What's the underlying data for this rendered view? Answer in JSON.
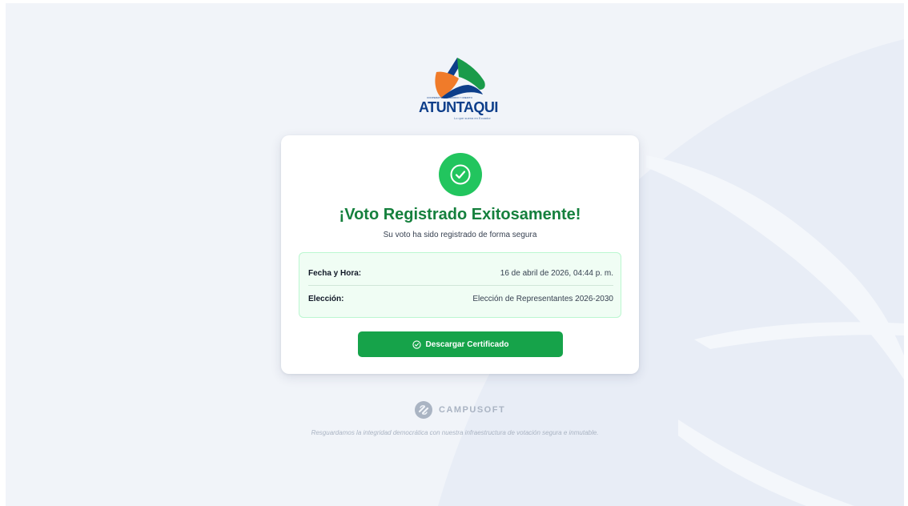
{
  "logo": {
    "wordmark": "ATUNTAQUI",
    "top_line": "COOPERATIVA DE AHORRO Y CREDITO",
    "slogan": "Lo que suena en Ecuador"
  },
  "result": {
    "title": "¡Voto Registrado Exitosamente!",
    "subtitle": "Su voto ha sido registrado de forma segura",
    "icon": "check-circle-icon"
  },
  "details": [
    {
      "label": "Fecha y Hora:",
      "value": "16 de abril de 2026, 04:44 p. m."
    },
    {
      "label": "Elección:",
      "value": "Elección de Representantes 2026-2030"
    }
  ],
  "actions": {
    "download_label": "Descargar Certificado"
  },
  "footer": {
    "brand": "CAMPUSOFT",
    "tagline": "Resguardamos la integridad democrática con nuestra infraestructura de votación segura e inmutable."
  },
  "colors": {
    "success": "#22c55e",
    "success_dark": "#15803d",
    "button": "#16a34a",
    "page_bg": "#f1f4f9",
    "brand_blue": "#0d3e8a",
    "brand_orange": "#f07b2a",
    "brand_green": "#1a9b4a"
  }
}
